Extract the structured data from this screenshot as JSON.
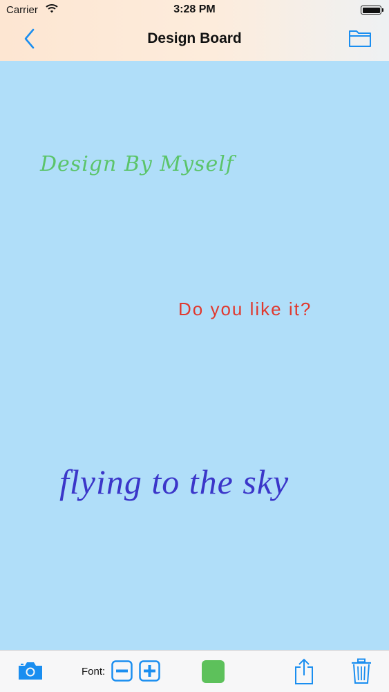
{
  "status_bar": {
    "carrier": "Carrier",
    "time": "3:28 PM",
    "battery_level": 1.0
  },
  "nav": {
    "title": "Design Board",
    "back_icon": "chevron-left-icon",
    "folder_icon": "folder-icon"
  },
  "canvas": {
    "background": "#b0def9",
    "texts": [
      {
        "text": "Design By Myself",
        "color": "#5bc46a"
      },
      {
        "text": "Do you like it?",
        "color": "#e0392f"
      },
      {
        "text": "flying to the sky",
        "color": "#3b36c9"
      }
    ]
  },
  "toolbar": {
    "camera_icon": "camera-icon",
    "font_label": "Font:",
    "font_decrease_icon": "minus-icon",
    "font_increase_icon": "plus-icon",
    "selected_color": "#5dc15b",
    "share_icon": "share-icon",
    "trash_icon": "trash-icon"
  },
  "colors": {
    "accent": "#1a8ef0"
  }
}
